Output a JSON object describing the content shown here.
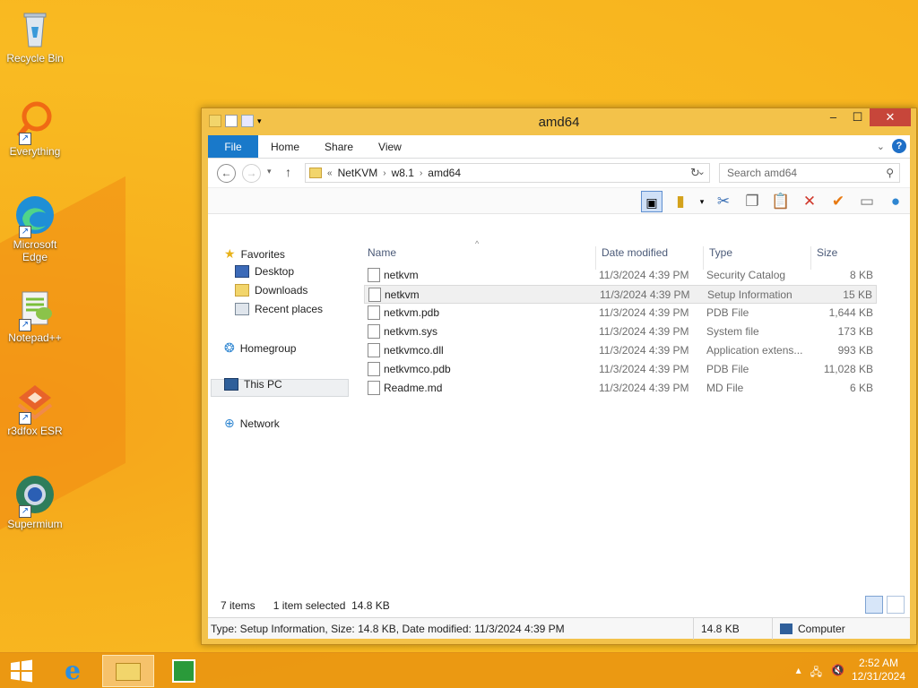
{
  "desktop": {
    "icons": [
      {
        "label": "Recycle Bin",
        "icon": "recycle-bin-icon"
      },
      {
        "label": "Everything",
        "icon": "everything-icon"
      },
      {
        "label": "Microsoft Edge",
        "icon": "edge-icon"
      },
      {
        "label": "Notepad++",
        "icon": "notepad-plus-plus-icon"
      },
      {
        "label": "r3dfox ESR",
        "icon": "r3dfox-icon"
      },
      {
        "label": "Supermium",
        "icon": "supermium-icon"
      }
    ]
  },
  "window": {
    "title": "amd64",
    "ribbon": {
      "tabs": [
        "File",
        "Home",
        "Share",
        "View"
      ]
    },
    "address": {
      "crumbs": [
        "NetKVM",
        "w8.1",
        "amd64"
      ],
      "prefix": "«"
    },
    "search": {
      "placeholder": "Search amd64"
    },
    "nav": {
      "favorites": "Favorites",
      "desktop": "Desktop",
      "downloads": "Downloads",
      "recent": "Recent places",
      "homegroup": "Homegroup",
      "thispc": "This PC",
      "network": "Network"
    },
    "columns": {
      "name": "Name",
      "date": "Date modified",
      "type": "Type",
      "size": "Size"
    },
    "files": [
      {
        "name": "netkvm",
        "date": "11/3/2024 4:39 PM",
        "type": "Security Catalog",
        "size": "8 KB",
        "selected": false
      },
      {
        "name": "netkvm",
        "date": "11/3/2024 4:39 PM",
        "type": "Setup Information",
        "size": "15 KB",
        "selected": true
      },
      {
        "name": "netkvm.pdb",
        "date": "11/3/2024 4:39 PM",
        "type": "PDB File",
        "size": "1,644 KB",
        "selected": false
      },
      {
        "name": "netkvm.sys",
        "date": "11/3/2024 4:39 PM",
        "type": "System file",
        "size": "173 KB",
        "selected": false
      },
      {
        "name": "netkvmco.dll",
        "date": "11/3/2024 4:39 PM",
        "type": "Application extens...",
        "size": "993 KB",
        "selected": false
      },
      {
        "name": "netkvmco.pdb",
        "date": "11/3/2024 4:39 PM",
        "type": "PDB File",
        "size": "11,028 KB",
        "selected": false
      },
      {
        "name": "Readme.md",
        "date": "11/3/2024 4:39 PM",
        "type": "MD File",
        "size": "6 KB",
        "selected": false
      }
    ],
    "status": {
      "items": "7 items",
      "selected": "1 item selected  14.8 KB"
    },
    "statusbar": {
      "details": "Type: Setup Information, Size: 14.8 KB, Date modified: 11/3/2024 4:39 PM",
      "size": "14.8 KB",
      "location": "Computer"
    }
  },
  "taskbar": {
    "time": "2:52 AM",
    "date": "12/31/2024"
  },
  "colors": {
    "file_tab": "#1979ca",
    "close_button": "#c7463a",
    "window_frame": "#f3c24a"
  }
}
